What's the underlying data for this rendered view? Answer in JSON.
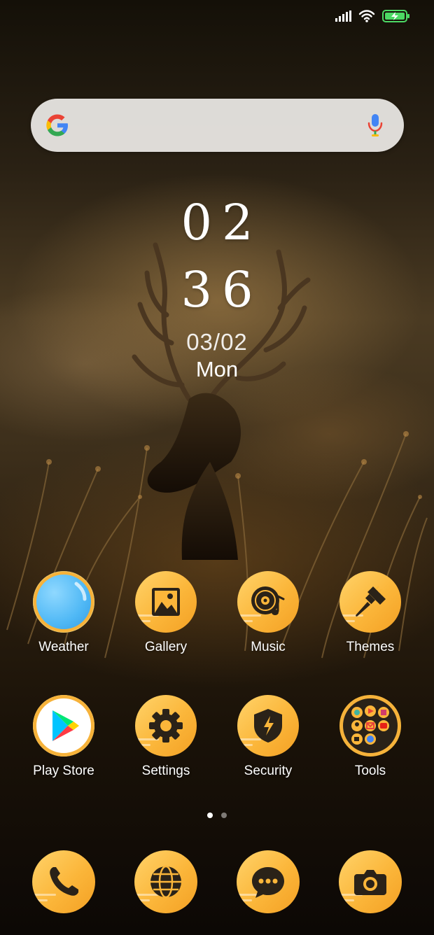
{
  "status_bar": {
    "signal_icon": "cellular-signal-icon",
    "wifi_icon": "wifi-icon",
    "battery_icon": "battery-charging-icon"
  },
  "search": {
    "logo_icon": "google-logo-icon",
    "mic_icon": "microphone-icon"
  },
  "clock": {
    "hours": "02",
    "minutes": "36",
    "date": "03/02",
    "day": "Mon"
  },
  "apps": [
    {
      "label": "Weather",
      "icon": "weather-icon"
    },
    {
      "label": "Gallery",
      "icon": "gallery-icon"
    },
    {
      "label": "Music",
      "icon": "music-icon"
    },
    {
      "label": "Themes",
      "icon": "paintbrush-icon"
    },
    {
      "label": "Play Store",
      "icon": "play-store-icon"
    },
    {
      "label": "Settings",
      "icon": "gear-icon"
    },
    {
      "label": "Security",
      "icon": "shield-icon"
    },
    {
      "label": "Tools",
      "icon": "folder-icon"
    }
  ],
  "page_indicator": {
    "pages": 2,
    "current": 1
  },
  "dock": [
    {
      "icon": "phone-icon"
    },
    {
      "icon": "browser-globe-icon"
    },
    {
      "icon": "messaging-icon"
    },
    {
      "icon": "camera-icon"
    }
  ],
  "colors": {
    "icon_orange": "#fbb63a",
    "icon_glyph": "#2a2218",
    "weather_blue": "#4fb8f5"
  }
}
